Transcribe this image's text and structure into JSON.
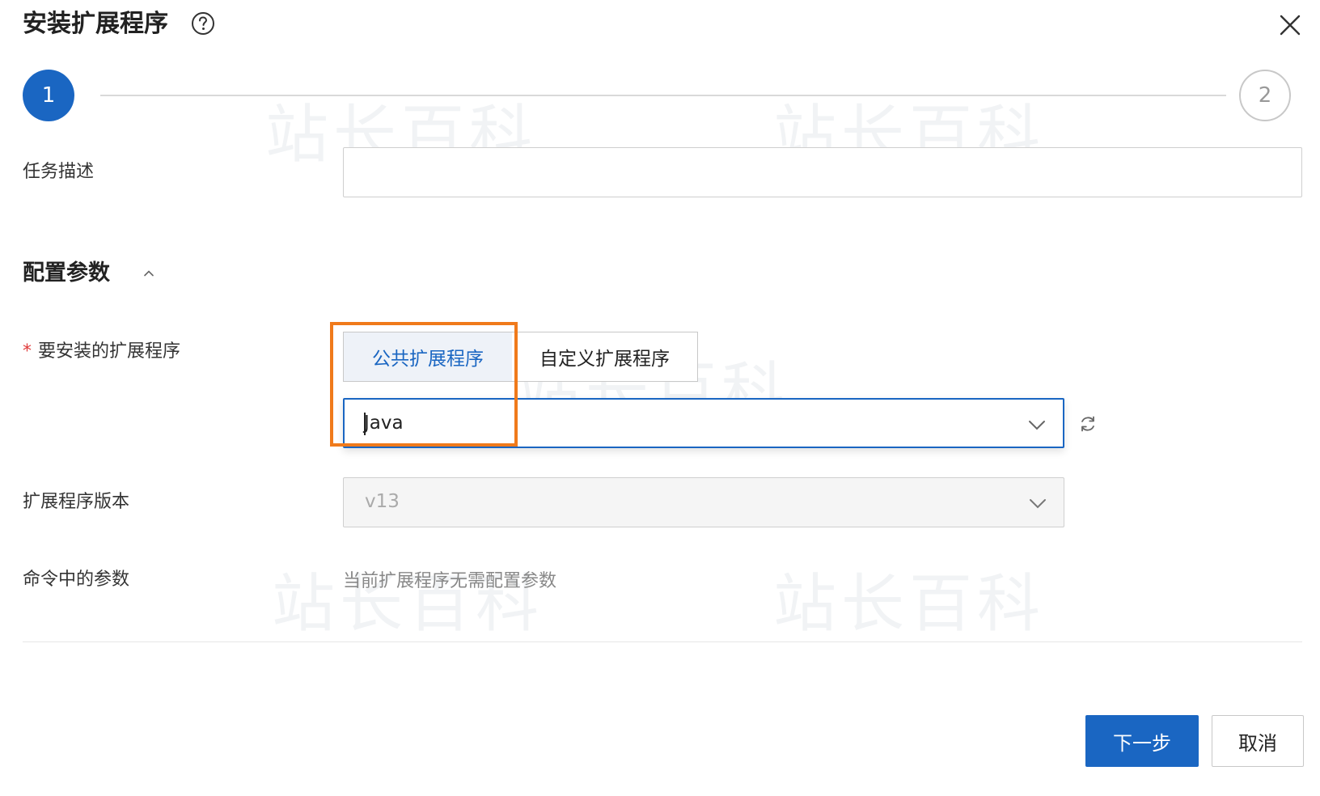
{
  "dialog": {
    "title": "安装扩展程序",
    "icons": {
      "help": "question-circle-icon",
      "close": "close-icon"
    }
  },
  "steps": {
    "step1": "1",
    "step2": "2"
  },
  "form": {
    "task_description": {
      "label": "任务描述",
      "value": ""
    },
    "config_section": {
      "title": "配置参数",
      "expanded": true
    },
    "extension": {
      "required_mark": "*",
      "label": "要安装的扩展程序",
      "tabs": [
        "公共扩展程序",
        "自定义扩展程序"
      ],
      "selected_tab": "公共扩展程序",
      "select_value": "Java"
    },
    "version": {
      "label": "扩展程序版本",
      "value": "v13"
    },
    "command_params": {
      "label": "命令中的参数",
      "text": "当前扩展程序无需配置参数"
    }
  },
  "footer": {
    "next_label": "下一步",
    "cancel_label": "取消"
  },
  "colors": {
    "primary": "#1a66c2",
    "highlight": "#f07a1b",
    "required": "#e03c3c"
  }
}
